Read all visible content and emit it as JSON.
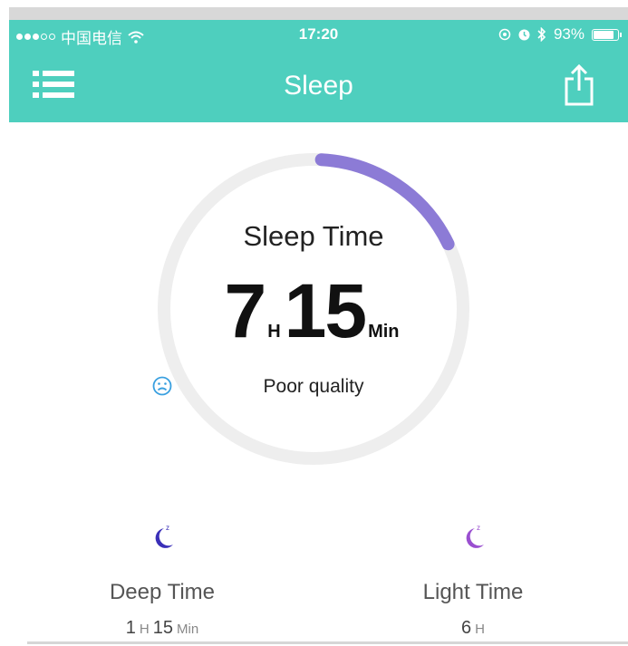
{
  "status_bar": {
    "carrier": "中国电信",
    "time": "17:20",
    "battery": "93%",
    "battery_level": 0.93
  },
  "header": {
    "title": "Sleep",
    "background_color": "#4ecfbe"
  },
  "sleep_summary": {
    "label": "Sleep Time",
    "hours": "7",
    "hours_unit": "H",
    "minutes": "15",
    "minutes_unit": "Min",
    "quality": "Poor quality",
    "progress_fraction": 0.17,
    "progress_color": "#8c7bd6",
    "track_color": "#eeeeee"
  },
  "stats": {
    "deep": {
      "label": "Deep Time",
      "hours": "1",
      "hours_unit": "H",
      "minutes": "15",
      "minutes_unit": "Min",
      "icon": "moon-icon",
      "icon_color": "#3a2fb8"
    },
    "light": {
      "label": "Light Time",
      "hours": "6",
      "hours_unit": "H",
      "icon": "moon-icon",
      "icon_color": "#9a4fd0"
    }
  }
}
